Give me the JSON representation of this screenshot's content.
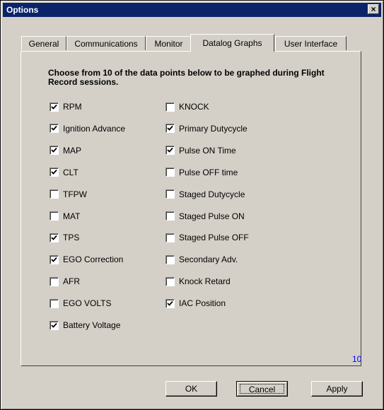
{
  "window": {
    "title": "Options",
    "close_glyph": "×"
  },
  "tabs": [
    {
      "label": "General",
      "active": false
    },
    {
      "label": "Communications",
      "active": false
    },
    {
      "label": "Monitor",
      "active": false
    },
    {
      "label": "Datalog Graphs",
      "active": true
    },
    {
      "label": "User Interface",
      "active": false
    }
  ],
  "instructions": "Choose from 10 of the data points below to be graphed during Flight Record sessions.",
  "left_column": [
    {
      "label": "RPM",
      "checked": true
    },
    {
      "label": "Ignition Advance",
      "checked": true
    },
    {
      "label": "MAP",
      "checked": true
    },
    {
      "label": "CLT",
      "checked": true
    },
    {
      "label": "TFPW",
      "checked": false
    },
    {
      "label": "MAT",
      "checked": false
    },
    {
      "label": "TPS",
      "checked": true
    },
    {
      "label": "EGO Correction",
      "checked": true
    },
    {
      "label": "AFR",
      "checked": false
    },
    {
      "label": "EGO VOLTS",
      "checked": false
    },
    {
      "label": "Battery Voltage",
      "checked": true
    }
  ],
  "right_column": [
    {
      "label": "KNOCK",
      "checked": false
    },
    {
      "label": "Primary Dutycycle",
      "checked": true
    },
    {
      "label": "Pulse ON Time",
      "checked": true
    },
    {
      "label": "Pulse OFF time",
      "checked": false
    },
    {
      "label": "Staged Dutycycle",
      "checked": false
    },
    {
      "label": "Staged Pulse ON",
      "checked": false
    },
    {
      "label": "Staged Pulse OFF",
      "checked": false
    },
    {
      "label": "Secondary Adv.",
      "checked": false
    },
    {
      "label": "Knock Retard",
      "checked": false
    },
    {
      "label": "IAC Position",
      "checked": true
    }
  ],
  "selected_count": "10",
  "buttons": {
    "ok": "OK",
    "cancel": "Cancel",
    "apply": "Apply"
  },
  "colors": {
    "titlebar": "#0a246a",
    "face": "#d4d0c8",
    "count": "#0000ff"
  }
}
